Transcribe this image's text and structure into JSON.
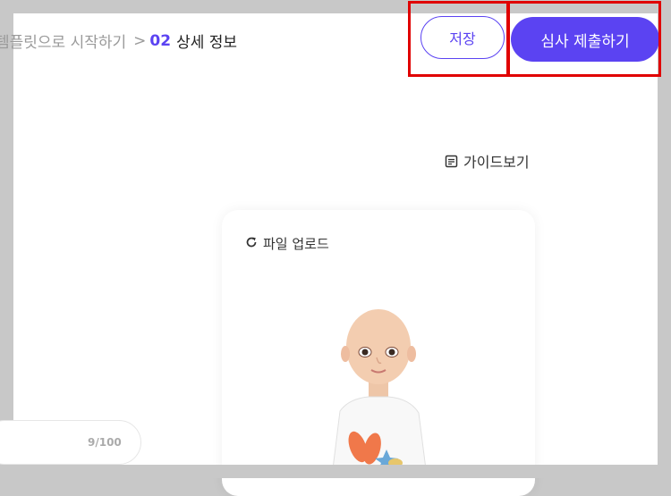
{
  "breadcrumb": {
    "previous": "템플릿으로 시작하기",
    "separator": ">",
    "step_number": "02",
    "current": "상세 정보"
  },
  "toolbar": {
    "save_label": "저장",
    "submit_label": "심사 제출하기"
  },
  "guide": {
    "label": "가이드보기",
    "icon": "document-icon"
  },
  "upload": {
    "label": "파일 업로드",
    "icon": "refresh-icon"
  },
  "text_counter": "9/100",
  "colors": {
    "accent": "#5b43f2",
    "highlight": "#e00000",
    "frame": "#c8c8c8"
  }
}
